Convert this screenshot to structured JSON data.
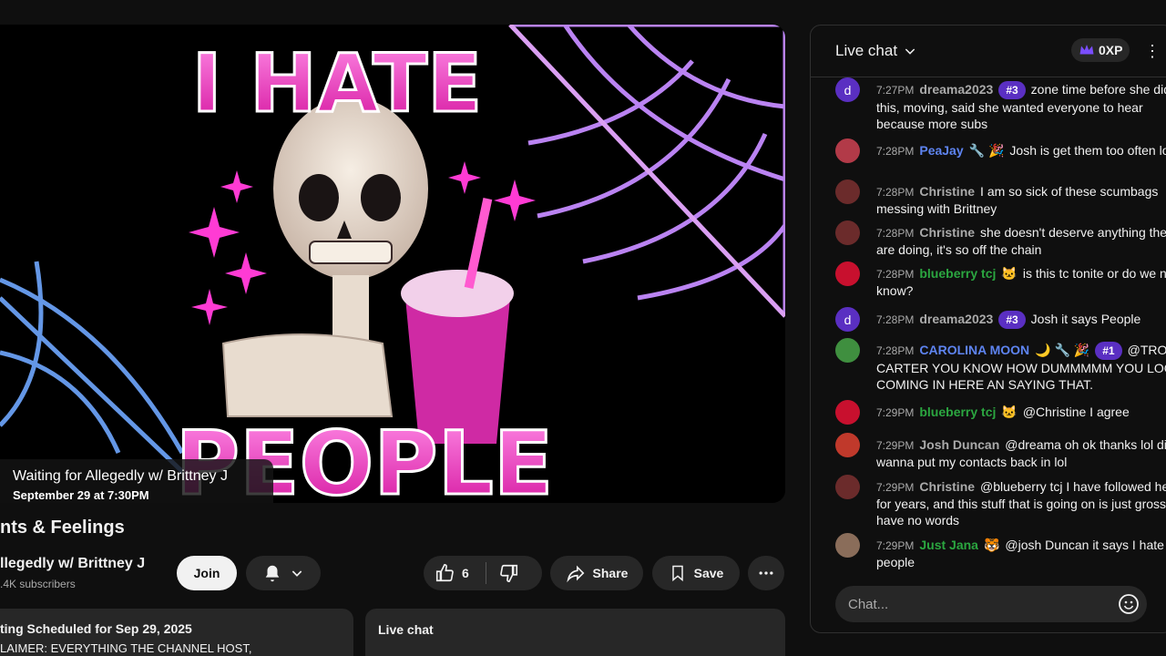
{
  "player": {
    "waiting_title": "Waiting for Allegedly w/ Brittney J",
    "waiting_date": "September 29 at 7:30PM",
    "art_text": [
      "I HATE",
      "PEOPLE"
    ]
  },
  "video": {
    "title": "nts & Feelings",
    "channel": "llegedly w/ Brittney J",
    "subscribers": ".4K subscribers",
    "join_label": "Join",
    "like_count": "6",
    "share_label": "Share",
    "save_label": "Save"
  },
  "description": {
    "line1": "ting  Scheduled for Sep 29, 2025",
    "line2": "LAIMER: EVERYTHING THE CHANNEL HOST,"
  },
  "chat_replay": {
    "title": "Live chat"
  },
  "chat": {
    "title": "Live chat",
    "xp": "0XP",
    "input_placeholder": "Chat...",
    "messages": [
      {
        "avatar": "d",
        "avatar_color": "#5a2fc2",
        "time": "7:27PM",
        "author": "dreama2023",
        "author_class": "",
        "badge": "#3",
        "extra": "",
        "text": "zone time before she did this, moving, said she wanted everyone to hear because more subs"
      },
      {
        "avatar": "",
        "avatar_color": "#b23a48",
        "time": "7:28PM",
        "author": "PeaJay",
        "author_class": "blue",
        "badge": "",
        "extra": "🔧 🎉",
        "text": "Josh is get them too often lol"
      },
      {
        "avatar": "",
        "avatar_color": "#6b2b2b",
        "time": "7:28PM",
        "author": "Christine",
        "author_class": "",
        "badge": "",
        "extra": "",
        "text": "I am so sick of these scumbags messing with Brittney"
      },
      {
        "avatar": "",
        "avatar_color": "#6b2b2b",
        "time": "7:28PM",
        "author": "Christine",
        "author_class": "",
        "badge": "",
        "extra": "",
        "text": "she doesn't deserve anything they are doing, it's so off the chain"
      },
      {
        "avatar": "",
        "avatar_color": "#c8102e",
        "time": "7:28PM",
        "author": "blueberry tcj",
        "author_class": "green",
        "badge": "",
        "extra": "🐱",
        "text": "is this tc tonite or do we not know?"
      },
      {
        "avatar": "d",
        "avatar_color": "#5a2fc2",
        "time": "7:28PM",
        "author": "dreama2023",
        "author_class": "",
        "badge": "#3",
        "extra": "",
        "text": "Josh it says People"
      },
      {
        "avatar": "",
        "avatar_color": "#3f8f3f",
        "time": "7:28PM",
        "author": "CAROLINA MOON",
        "author_class": "blue",
        "badge": "#1",
        "extra": "🌙 🔧 🎉",
        "text": "@TRON CARTER YOU KNOW HOW DUMMMMM YOU LOOK COMING IN HERE AN SAYING THAT."
      },
      {
        "avatar": "",
        "avatar_color": "#c8102e",
        "time": "7:29PM",
        "author": "blueberry tcj",
        "author_class": "green",
        "badge": "",
        "extra": "🐱",
        "text": "@Christine I agree"
      },
      {
        "avatar": "",
        "avatar_color": "#c0392b",
        "time": "7:29PM",
        "author": "Josh Duncan",
        "author_class": "",
        "badge": "",
        "extra": "",
        "text": "@dreama oh ok thanks lol didn't wanna put my contacts back in lol"
      },
      {
        "avatar": "",
        "avatar_color": "#6b2b2b",
        "time": "7:29PM",
        "author": "Christine",
        "author_class": "",
        "badge": "",
        "extra": "",
        "text": "@blueberry tcj I have followed her for years, and this stuff that is going on is just gross, I have no words"
      },
      {
        "avatar": "",
        "avatar_color": "#8a6d5a",
        "time": "7:29PM",
        "author": "Just Jana",
        "author_class": "green",
        "badge": "",
        "extra": "🐯",
        "text": "@josh Duncan it says I hate people"
      }
    ]
  },
  "colors": {
    "accent_purple": "#5a2fc2",
    "neon_pink": "#ff3bd4",
    "neon_blue": "#7fb3ff"
  }
}
